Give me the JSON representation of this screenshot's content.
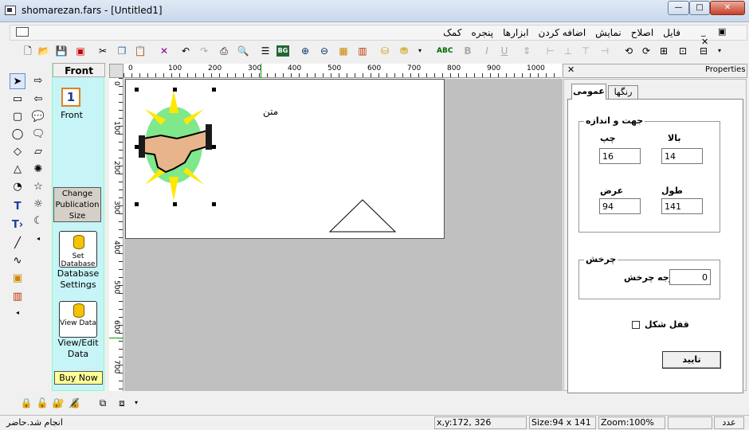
{
  "window": {
    "title": "shomarezan.fars - [Untitled1]",
    "min": "—",
    "max": "□",
    "close": "✕"
  },
  "menu": [
    "فایل",
    "اصلاح",
    "نمایش",
    "اضافه کردن",
    "ابزارها",
    "پنجره",
    "کمک"
  ],
  "mdi_buttons": "_ ▣ ✕",
  "page_panel": {
    "tab": "Front",
    "page_number": "1",
    "page_label": "Front",
    "change_publication": "Change Publication Size",
    "set_database_icon": "Set Database",
    "database_settings": "Database Settings",
    "view_data_icon": "View Data",
    "view_edit_data": "View/Edit Data",
    "buy_now": "Buy Now"
  },
  "ruler": {
    "h": [
      "0",
      "100",
      "200",
      "300",
      "400",
      "500",
      "600",
      "700",
      "800",
      "900",
      "1000"
    ],
    "v": [
      "0",
      "100",
      "200",
      "300",
      "400",
      "500",
      "600",
      "700"
    ]
  },
  "canvas": {
    "text_object": "متن"
  },
  "properties": {
    "title": "Properties",
    "tabs": [
      "عمومی",
      "رنگها"
    ],
    "group_position": "جهت و اندازه",
    "left_label": "چپ",
    "left_value": "16",
    "top_label": "بالا",
    "top_value": "14",
    "width_label": "عرض",
    "width_value": "94",
    "height_label": "طول",
    "height_value": "141",
    "group_rotation": "چرخش",
    "rotation_label": "درجه چرخش",
    "rotation_value": "0",
    "lock_label": "قفل شکل",
    "confirm": "تایید"
  },
  "status": {
    "message": "انجام شد.حاضر",
    "coords": "x,y:172, 326",
    "size": "Size:94 x 141",
    "zoom": "Zoom:100%",
    "num": "عدد"
  },
  "toolbar_icons": [
    "new-icon",
    "open-icon",
    "save-icon",
    "pdf-icon",
    "cut-icon",
    "copy-icon",
    "paste-icon",
    "delete-icon",
    "undo-icon",
    "redo-icon",
    "print-icon",
    "print-preview-icon",
    "properties-icon",
    "background-icon",
    "zoom-in-icon",
    "zoom-out-icon",
    "grid-icon",
    "table-icon",
    "database-icon",
    "view-data-icon",
    "spellcheck-icon",
    "bold-icon",
    "italic-icon",
    "underline-icon"
  ]
}
